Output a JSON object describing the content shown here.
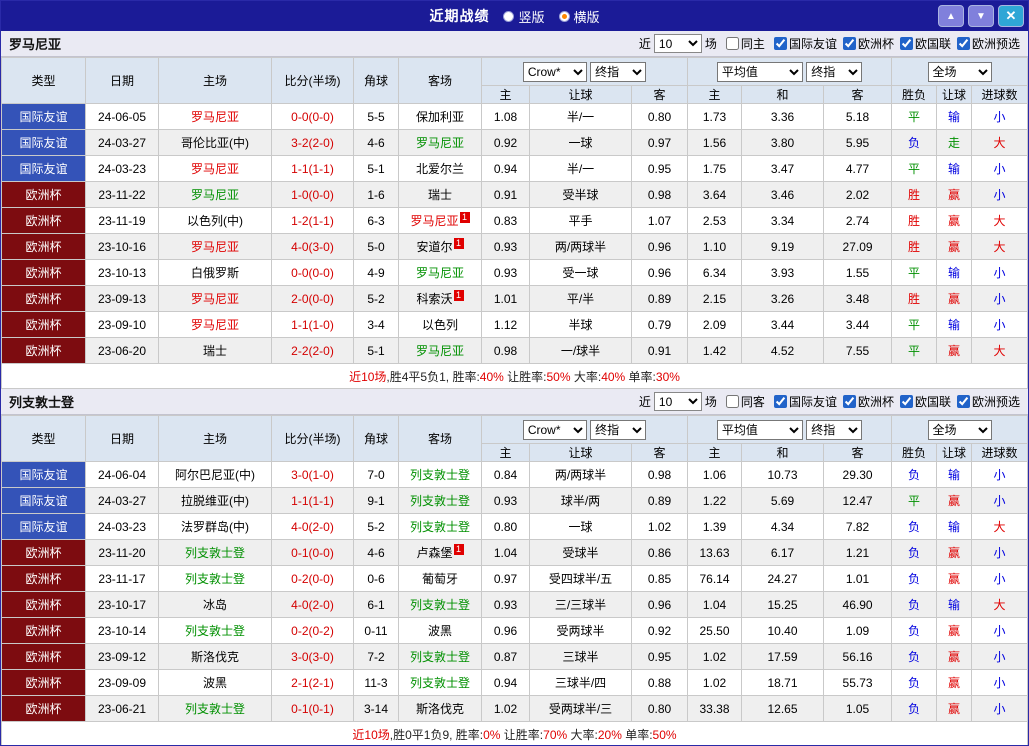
{
  "titlebar": {
    "title": "近期战绩",
    "radios": [
      {
        "label": "竖版",
        "selected": false
      },
      {
        "label": "横版",
        "selected": true
      }
    ],
    "buttons": {
      "up": "▲",
      "down": "▼",
      "close": "✕"
    }
  },
  "league_colors": {
    "blue": "#3453b8",
    "maroon": "#7d0c10"
  },
  "name_colors": {
    "red": "#e00000",
    "green": "#009000",
    "black": "#000000"
  },
  "result_colors": {
    "胜": "#e00000",
    "赢": "#e00000",
    "大": "#e00000",
    "平": "#009000",
    "走": "#009000",
    "负": "#0000e0",
    "输": "#0000e0",
    "小": "#0000e0"
  },
  "sections": [
    {
      "team": "罗马尼亚",
      "filters": {
        "near": "近",
        "count": "10",
        "games": "场",
        "same": "同主",
        "same_checked": false,
        "leagues": [
          "国际友谊",
          "欧洲杯",
          "欧国联",
          "欧洲预选"
        ]
      },
      "columns": {
        "main": [
          "类型",
          "日期",
          "主场",
          "比分(半场)",
          "角球",
          "客场"
        ],
        "sub": [
          "主",
          "让球",
          "客",
          "主",
          "和",
          "客",
          "胜负",
          "让球",
          "进球数"
        ]
      },
      "selects": {
        "odds1": "Crow*",
        "odds2": "终指",
        "avg1": "平均值",
        "avg2": "终指",
        "scope": "全场"
      },
      "rows": [
        {
          "league": "国际友谊",
          "league_color": "blue",
          "date": "24-06-05",
          "home": "罗马尼亚",
          "home_color": "red",
          "home_badge": "",
          "score": "0-0(0-0)",
          "corner": "5-5",
          "away": "保加利亚",
          "away_color": "black",
          "away_badge": "",
          "odds": [
            "1.08",
            "半/一",
            "0.80"
          ],
          "avg": [
            "1.73",
            "3.36",
            "5.18"
          ],
          "results": [
            "平",
            "输",
            "小"
          ]
        },
        {
          "league": "国际友谊",
          "league_color": "blue",
          "date": "24-03-27",
          "home": "哥伦比亚(中)",
          "home_color": "black",
          "home_badge": "",
          "score": "3-2(2-0)",
          "corner": "4-6",
          "away": "罗马尼亚",
          "away_color": "green",
          "away_badge": "",
          "odds": [
            "0.92",
            "一球",
            "0.97"
          ],
          "avg": [
            "1.56",
            "3.80",
            "5.95"
          ],
          "results": [
            "负",
            "走",
            "大"
          ]
        },
        {
          "league": "国际友谊",
          "league_color": "blue",
          "date": "24-03-23",
          "home": "罗马尼亚",
          "home_color": "red",
          "home_badge": "",
          "score": "1-1(1-1)",
          "corner": "5-1",
          "away": "北爱尔兰",
          "away_color": "black",
          "away_badge": "",
          "odds": [
            "0.94",
            "半/一",
            "0.95"
          ],
          "avg": [
            "1.75",
            "3.47",
            "4.77"
          ],
          "results": [
            "平",
            "输",
            "小"
          ]
        },
        {
          "league": "欧洲杯",
          "league_color": "maroon",
          "date": "23-11-22",
          "home": "罗马尼亚",
          "home_color": "green",
          "home_badge": "",
          "score": "1-0(0-0)",
          "corner": "1-6",
          "away": "瑞士",
          "away_color": "black",
          "away_badge": "",
          "odds": [
            "0.91",
            "受半球",
            "0.98"
          ],
          "avg": [
            "3.64",
            "3.46",
            "2.02"
          ],
          "results": [
            "胜",
            "赢",
            "小"
          ]
        },
        {
          "league": "欧洲杯",
          "league_color": "maroon",
          "date": "23-11-19",
          "home": "以色列(中)",
          "home_color": "black",
          "home_badge": "",
          "score": "1-2(1-1)",
          "corner": "6-3",
          "away": "罗马尼亚",
          "away_color": "red",
          "away_badge": "1",
          "odds": [
            "0.83",
            "平手",
            "1.07"
          ],
          "avg": [
            "2.53",
            "3.34",
            "2.74"
          ],
          "results": [
            "胜",
            "赢",
            "大"
          ]
        },
        {
          "league": "欧洲杯",
          "league_color": "maroon",
          "date": "23-10-16",
          "home": "罗马尼亚",
          "home_color": "red",
          "home_badge": "",
          "score": "4-0(3-0)",
          "corner": "5-0",
          "away": "安道尔",
          "away_color": "black",
          "away_badge": "1",
          "odds": [
            "0.93",
            "两/两球半",
            "0.96"
          ],
          "avg": [
            "1.10",
            "9.19",
            "27.09"
          ],
          "results": [
            "胜",
            "赢",
            "大"
          ]
        },
        {
          "league": "欧洲杯",
          "league_color": "maroon",
          "date": "23-10-13",
          "home": "白俄罗斯",
          "home_color": "black",
          "home_badge": "",
          "score": "0-0(0-0)",
          "corner": "4-9",
          "away": "罗马尼亚",
          "away_color": "green",
          "away_badge": "",
          "odds": [
            "0.93",
            "受一球",
            "0.96"
          ],
          "avg": [
            "6.34",
            "3.93",
            "1.55"
          ],
          "results": [
            "平",
            "输",
            "小"
          ]
        },
        {
          "league": "欧洲杯",
          "league_color": "maroon",
          "date": "23-09-13",
          "home": "罗马尼亚",
          "home_color": "red",
          "home_badge": "",
          "score": "2-0(0-0)",
          "corner": "5-2",
          "away": "科索沃",
          "away_color": "black",
          "away_badge": "1",
          "odds": [
            "1.01",
            "平/半",
            "0.89"
          ],
          "avg": [
            "2.15",
            "3.26",
            "3.48"
          ],
          "results": [
            "胜",
            "赢",
            "小"
          ]
        },
        {
          "league": "欧洲杯",
          "league_color": "maroon",
          "date": "23-09-10",
          "home": "罗马尼亚",
          "home_color": "red",
          "home_badge": "",
          "score": "1-1(1-0)",
          "corner": "3-4",
          "away": "以色列",
          "away_color": "black",
          "away_badge": "",
          "odds": [
            "1.12",
            "半球",
            "0.79"
          ],
          "avg": [
            "2.09",
            "3.44",
            "3.44"
          ],
          "results": [
            "平",
            "输",
            "小"
          ]
        },
        {
          "league": "欧洲杯",
          "league_color": "maroon",
          "date": "23-06-20",
          "home": "瑞士",
          "home_color": "black",
          "home_badge": "",
          "score": "2-2(2-0)",
          "corner": "5-1",
          "away": "罗马尼亚",
          "away_color": "green",
          "away_badge": "",
          "odds": [
            "0.98",
            "一/球半",
            "0.91"
          ],
          "avg": [
            "1.42",
            "4.52",
            "7.55"
          ],
          "results": [
            "平",
            "赢",
            "大"
          ]
        }
      ],
      "summary": [
        {
          "t": "近10场",
          "c": "red"
        },
        {
          "t": ",胜4平5负1, 胜率:",
          "c": "black"
        },
        {
          "t": "40%",
          "c": "red"
        },
        {
          "t": " 让胜率:",
          "c": "black"
        },
        {
          "t": "50%",
          "c": "red"
        },
        {
          "t": " 大率:",
          "c": "black"
        },
        {
          "t": "40%",
          "c": "red"
        },
        {
          "t": " 单率:",
          "c": "black"
        },
        {
          "t": "30%",
          "c": "red"
        }
      ]
    },
    {
      "team": "列支敦士登",
      "filters": {
        "near": "近",
        "count": "10",
        "games": "场",
        "same": "同客",
        "same_checked": false,
        "leagues": [
          "国际友谊",
          "欧洲杯",
          "欧国联",
          "欧洲预选"
        ]
      },
      "columns": {
        "main": [
          "类型",
          "日期",
          "主场",
          "比分(半场)",
          "角球",
          "客场"
        ],
        "sub": [
          "主",
          "让球",
          "客",
          "主",
          "和",
          "客",
          "胜负",
          "让球",
          "进球数"
        ]
      },
      "selects": {
        "odds1": "Crow*",
        "odds2": "终指",
        "avg1": "平均值",
        "avg2": "终指",
        "scope": "全场"
      },
      "rows": [
        {
          "league": "国际友谊",
          "league_color": "blue",
          "date": "24-06-04",
          "home": "阿尔巴尼亚(中)",
          "home_color": "black",
          "home_badge": "",
          "score": "3-0(1-0)",
          "corner": "7-0",
          "away": "列支敦士登",
          "away_color": "green",
          "away_badge": "",
          "odds": [
            "0.84",
            "两/两球半",
            "0.98"
          ],
          "avg": [
            "1.06",
            "10.73",
            "29.30"
          ],
          "results": [
            "负",
            "输",
            "小"
          ]
        },
        {
          "league": "国际友谊",
          "league_color": "blue",
          "date": "24-03-27",
          "home": "拉脱维亚(中)",
          "home_color": "black",
          "home_badge": "",
          "score": "1-1(1-1)",
          "corner": "9-1",
          "away": "列支敦士登",
          "away_color": "green",
          "away_badge": "",
          "odds": [
            "0.93",
            "球半/两",
            "0.89"
          ],
          "avg": [
            "1.22",
            "5.69",
            "12.47"
          ],
          "results": [
            "平",
            "赢",
            "小"
          ]
        },
        {
          "league": "国际友谊",
          "league_color": "blue",
          "date": "24-03-23",
          "home": "法罗群岛(中)",
          "home_color": "black",
          "home_badge": "",
          "score": "4-0(2-0)",
          "corner": "5-2",
          "away": "列支敦士登",
          "away_color": "green",
          "away_badge": "",
          "odds": [
            "0.80",
            "一球",
            "1.02"
          ],
          "avg": [
            "1.39",
            "4.34",
            "7.82"
          ],
          "results": [
            "负",
            "输",
            "大"
          ]
        },
        {
          "league": "欧洲杯",
          "league_color": "maroon",
          "date": "23-11-20",
          "home": "列支敦士登",
          "home_color": "green",
          "home_badge": "",
          "score": "0-1(0-0)",
          "corner": "4-6",
          "away": "卢森堡",
          "away_color": "black",
          "away_badge": "1",
          "odds": [
            "1.04",
            "受球半",
            "0.86"
          ],
          "avg": [
            "13.63",
            "6.17",
            "1.21"
          ],
          "results": [
            "负",
            "赢",
            "小"
          ]
        },
        {
          "league": "欧洲杯",
          "league_color": "maroon",
          "date": "23-11-17",
          "home": "列支敦士登",
          "home_color": "green",
          "home_badge": "",
          "score": "0-2(0-0)",
          "corner": "0-6",
          "away": "葡萄牙",
          "away_color": "black",
          "away_badge": "",
          "odds": [
            "0.97",
            "受四球半/五",
            "0.85"
          ],
          "avg": [
            "76.14",
            "24.27",
            "1.01"
          ],
          "results": [
            "负",
            "赢",
            "小"
          ]
        },
        {
          "league": "欧洲杯",
          "league_color": "maroon",
          "date": "23-10-17",
          "home": "冰岛",
          "home_color": "black",
          "home_badge": "",
          "score": "4-0(2-0)",
          "corner": "6-1",
          "away": "列支敦士登",
          "away_color": "green",
          "away_badge": "",
          "odds": [
            "0.93",
            "三/三球半",
            "0.96"
          ],
          "avg": [
            "1.04",
            "15.25",
            "46.90"
          ],
          "results": [
            "负",
            "输",
            "大"
          ]
        },
        {
          "league": "欧洲杯",
          "league_color": "maroon",
          "date": "23-10-14",
          "home": "列支敦士登",
          "home_color": "green",
          "home_badge": "",
          "score": "0-2(0-2)",
          "corner": "0-11",
          "away": "波黑",
          "away_color": "black",
          "away_badge": "",
          "odds": [
            "0.96",
            "受两球半",
            "0.92"
          ],
          "avg": [
            "25.50",
            "10.40",
            "1.09"
          ],
          "results": [
            "负",
            "赢",
            "小"
          ]
        },
        {
          "league": "欧洲杯",
          "league_color": "maroon",
          "date": "23-09-12",
          "home": "斯洛伐克",
          "home_color": "black",
          "home_badge": "",
          "score": "3-0(3-0)",
          "corner": "7-2",
          "away": "列支敦士登",
          "away_color": "green",
          "away_badge": "",
          "odds": [
            "0.87",
            "三球半",
            "0.95"
          ],
          "avg": [
            "1.02",
            "17.59",
            "56.16"
          ],
          "results": [
            "负",
            "赢",
            "小"
          ]
        },
        {
          "league": "欧洲杯",
          "league_color": "maroon",
          "date": "23-09-09",
          "home": "波黑",
          "home_color": "black",
          "home_badge": "",
          "score": "2-1(2-1)",
          "corner": "11-3",
          "away": "列支敦士登",
          "away_color": "green",
          "away_badge": "",
          "odds": [
            "0.94",
            "三球半/四",
            "0.88"
          ],
          "avg": [
            "1.02",
            "18.71",
            "55.73"
          ],
          "results": [
            "负",
            "赢",
            "小"
          ]
        },
        {
          "league": "欧洲杯",
          "league_color": "maroon",
          "date": "23-06-21",
          "home": "列支敦士登",
          "home_color": "green",
          "home_badge": "",
          "score": "0-1(0-1)",
          "corner": "3-14",
          "away": "斯洛伐克",
          "away_color": "black",
          "away_badge": "",
          "odds": [
            "1.02",
            "受两球半/三",
            "0.80"
          ],
          "avg": [
            "33.38",
            "12.65",
            "1.05"
          ],
          "results": [
            "负",
            "赢",
            "小"
          ]
        }
      ],
      "summary": [
        {
          "t": "近10场",
          "c": "red"
        },
        {
          "t": ",胜0平1负9, 胜率:",
          "c": "black"
        },
        {
          "t": "0%",
          "c": "red"
        },
        {
          "t": " 让胜率:",
          "c": "black"
        },
        {
          "t": "70%",
          "c": "red"
        },
        {
          "t": " 大率:",
          "c": "black"
        },
        {
          "t": "20%",
          "c": "red"
        },
        {
          "t": " 单率:",
          "c": "black"
        },
        {
          "t": "50%",
          "c": "red"
        }
      ]
    }
  ]
}
